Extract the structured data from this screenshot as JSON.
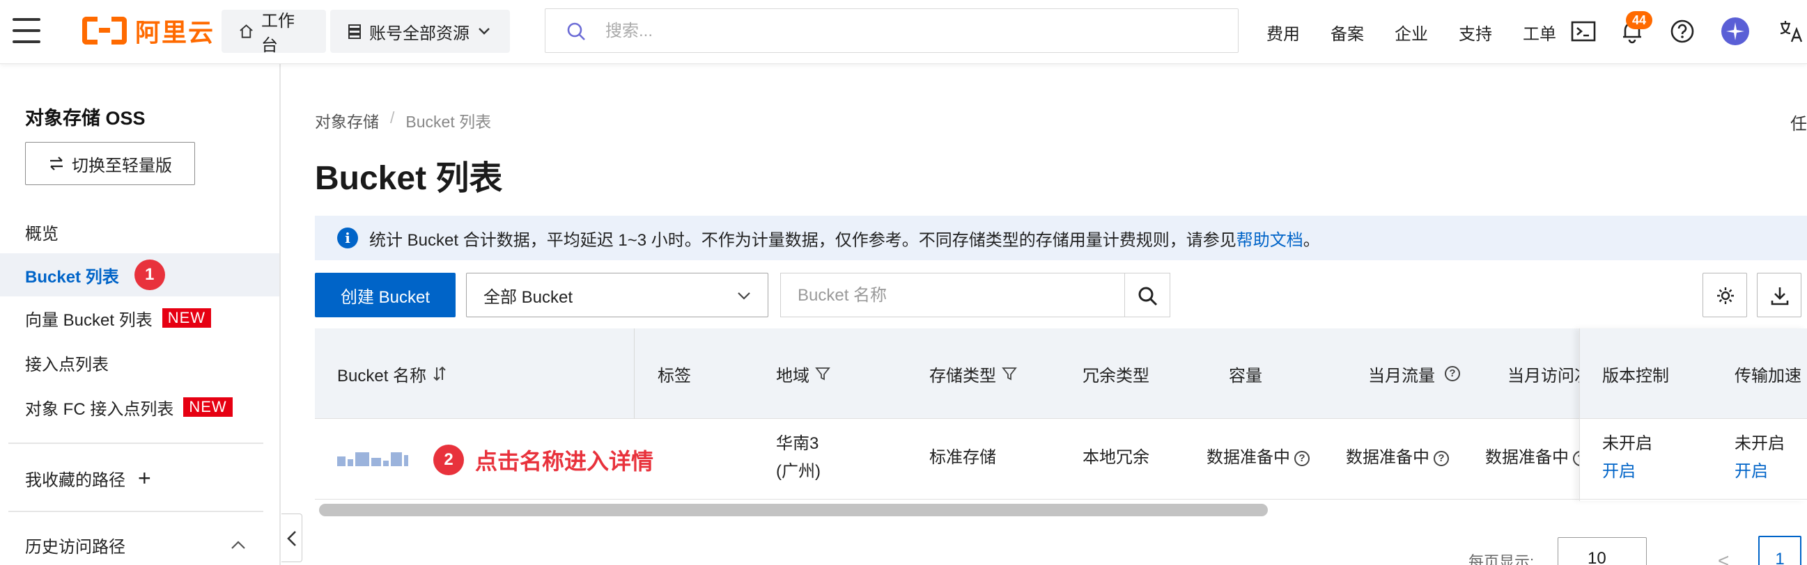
{
  "topbar": {
    "logo_text": "阿里云",
    "home_label": "工作台",
    "resource_label": "账号全部资源",
    "search_placeholder": "搜索...",
    "links": [
      "费用",
      "备案",
      "企业",
      "支持",
      "工单"
    ],
    "notification_count": "44",
    "accent_color": "#ff6a00"
  },
  "sidebar": {
    "title": "对象存储 OSS",
    "switch_label": "切换至轻量版",
    "items": [
      {
        "label": "概览"
      },
      {
        "label": "Bucket 列表",
        "step": "1"
      },
      {
        "label": "向量 Bucket 列表",
        "tag": "NEW"
      },
      {
        "label": "接入点列表"
      },
      {
        "label": "对象 FC 接入点列表",
        "tag": "NEW"
      }
    ],
    "favorites_label": "我收藏的路径",
    "favorites_add": "+",
    "history_label": "历史访问路径"
  },
  "main": {
    "breadcrumb": [
      "对象存储",
      "Bucket 列表"
    ],
    "breadcrumb_sep": "/",
    "title": "Bucket 列表",
    "right_edge_text": "任",
    "info": {
      "text": "统计 Bucket 合计数据，平均延迟 1~3 小时。不作为计量数据，仅作参考。不同存储类型的存储用量计费规则，请参见",
      "link": "帮助文档",
      "suffix": "。"
    },
    "toolbar": {
      "create_label": "创建 Bucket",
      "filter_select": "全部 Bucket",
      "name_placeholder": "Bucket 名称"
    },
    "table": {
      "columns": [
        "Bucket 名称",
        "标签",
        "地域",
        "存储类型",
        "冗余类型",
        "容量",
        "当月流量",
        "当月访问次",
        "版本控制",
        "传输加速"
      ],
      "row": {
        "annotation_step": "2",
        "annotation_text": "点击名称进入详情",
        "region_line1": "华南3",
        "region_line2": "(广州)",
        "storage_type": "标准存储",
        "redundancy": "本地冗余",
        "capacity": "数据准备中",
        "traffic": "数据准备中",
        "visits": "数据准备中",
        "versioning_status": "未开启",
        "versioning_action": "开启",
        "acceleration_status": "未开启",
        "acceleration_action": "开启"
      }
    },
    "pager": {
      "per_page_label": "每页显示:",
      "per_page_value": "10",
      "prev": "<",
      "current_page": "1"
    }
  }
}
